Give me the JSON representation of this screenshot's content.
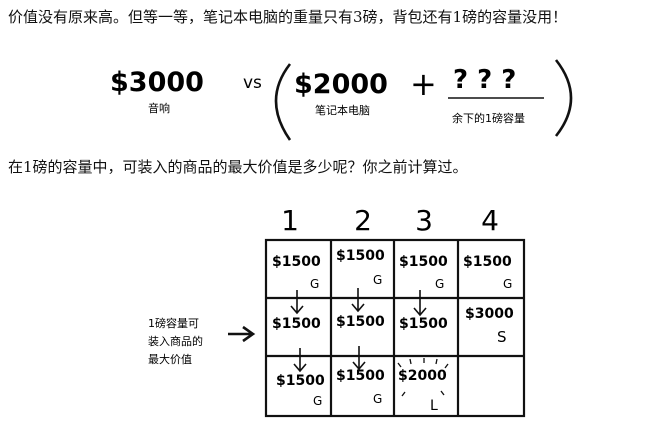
{
  "paragraph1": "价值没有原来高。但等一等，笔记本电脑的重量只有3磅，背包还有1磅的容量没用！",
  "paragraph2": "在1磅的容量中，可装入的商品的最大价值是多少呢？你之前计算过。",
  "equation": {
    "left_value": "$3000",
    "left_caption": "音响",
    "vs": "vs",
    "laptop_value": "$2000",
    "laptop_caption": "笔记本电脑",
    "plus": "+",
    "unknown": "? ? ?",
    "unknown_caption": "余下的1磅容量"
  },
  "grid": {
    "columns": [
      "1",
      "2",
      "3",
      "4"
    ],
    "rows": [
      [
        {
          "value": "$1500",
          "item": "G"
        },
        {
          "value": "$1500",
          "item": "G"
        },
        {
          "value": "$1500",
          "item": "G"
        },
        {
          "value": "$1500",
          "item": "G"
        }
      ],
      [
        {
          "value": "$1500",
          "item": ""
        },
        {
          "value": "$1500",
          "item": ""
        },
        {
          "value": "$1500",
          "item": ""
        },
        {
          "value": "$3000",
          "item": "S"
        }
      ],
      [
        {
          "value": "$1500",
          "item": "G"
        },
        {
          "value": "$1500",
          "item": "G"
        },
        {
          "value": "$2000",
          "item": "L"
        },
        {
          "value": "",
          "item": ""
        }
      ]
    ]
  },
  "annotation": [
    "1磅容量可",
    "装入商品的",
    "最大价值"
  ]
}
